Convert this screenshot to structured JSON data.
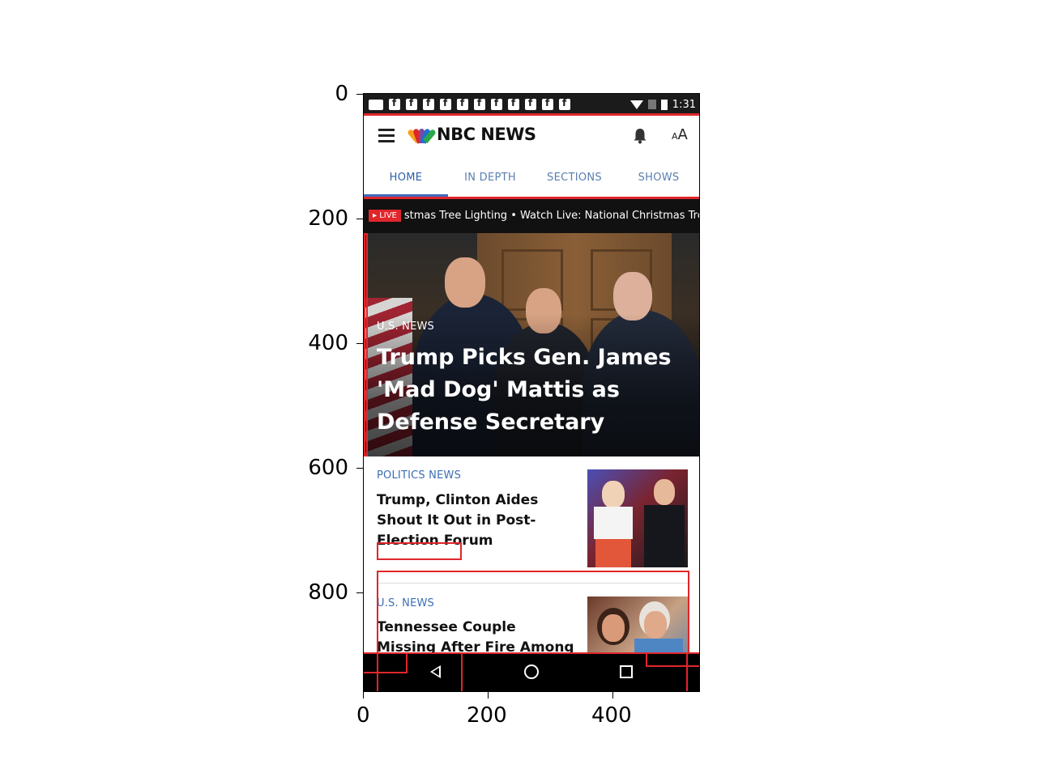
{
  "status_bar": {
    "time": "1:31"
  },
  "app_bar": {
    "logo_text": "NBC NEWS",
    "font_size_large": "A",
    "font_size_small": "A"
  },
  "tabs": [
    {
      "label": "HOME",
      "active": true
    },
    {
      "label": "IN DEPTH",
      "active": false
    },
    {
      "label": "SECTIONS",
      "active": false
    },
    {
      "label": "SHOWS",
      "active": false
    }
  ],
  "ticker": {
    "badge": "▸ LIVE",
    "text": "stmas Tree Lighting  •  Watch Live: National Christmas Tree"
  },
  "hero": {
    "category": "U.S. NEWS",
    "title": "Trump Picks Gen. James 'Mad Dog' Mattis as Defense Secretary"
  },
  "stories": [
    {
      "category": "POLITICS NEWS",
      "title": "Trump, Clinton Aides Shout It Out in Post-Election Forum"
    },
    {
      "category": "U.S. NEWS",
      "title": "Tennessee Couple Missing After Fire Among Dead:"
    }
  ],
  "axes": {
    "y_ticks": [
      "0",
      "200",
      "400",
      "600",
      "800"
    ],
    "x_ticks": [
      "0",
      "200",
      "400"
    ]
  },
  "colors": {
    "accent": "#3d6cc0",
    "live_red": "#e0262b",
    "annotation": "#e0262b"
  }
}
